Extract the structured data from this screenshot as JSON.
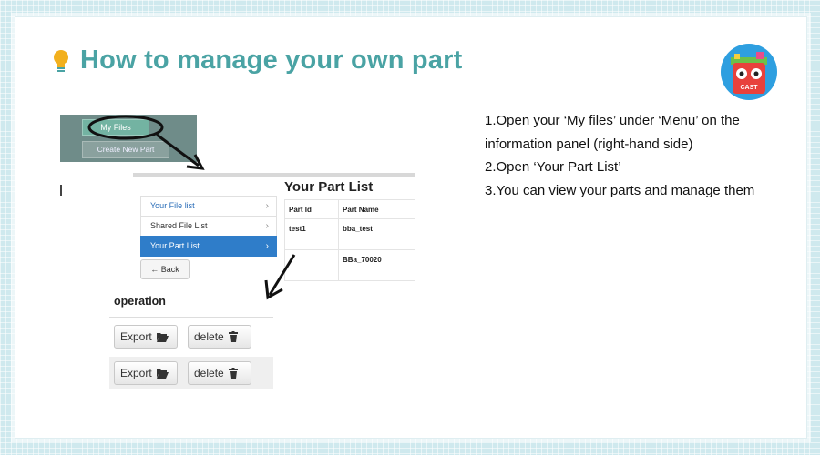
{
  "slide": {
    "title": "How to manage your own part",
    "instructions": [
      "1.Open your ‘My files’ under ‘Menu’ on the information panel (right-hand side)",
      "2.Open ‘Your Part List’",
      "3.You can view your parts and manage them"
    ],
    "logo_text": "CAST",
    "accent_color": "#4aa3a4"
  },
  "menu_panel": {
    "my_files_label": "My Files",
    "create_new_part_label": "Create New Part"
  },
  "file_nav": {
    "items": [
      {
        "label": "Your File list",
        "chevron": "›"
      },
      {
        "label": "Shared File List",
        "chevron": "›"
      },
      {
        "label": "Your Part List",
        "chevron": "›",
        "active": true
      }
    ],
    "back_label": "Back",
    "back_icon": "←"
  },
  "part_list": {
    "title": "Your Part List",
    "columns": [
      "Part Id",
      "Part Name"
    ],
    "rows": [
      [
        "test1",
        "bba_test"
      ],
      [
        "",
        "BBa_70020"
      ]
    ]
  },
  "operation": {
    "title": "operation",
    "rows": [
      {
        "export_label": "Export",
        "delete_label": "delete"
      },
      {
        "export_label": "Export",
        "delete_label": "delete"
      }
    ]
  }
}
